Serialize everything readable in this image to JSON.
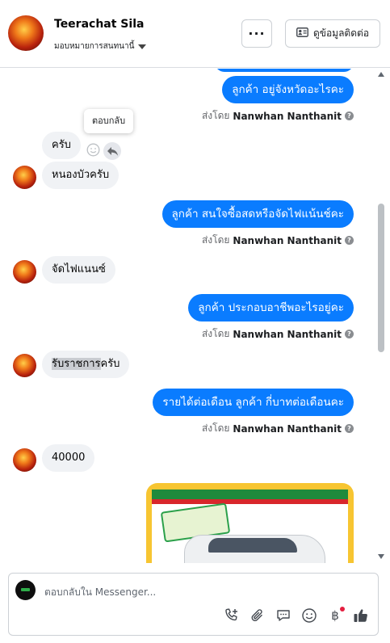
{
  "header": {
    "name": "Teerachat Sila",
    "assign_label": "มอบหมายการสนทนานี้",
    "more_label": "···",
    "contact_button_label": "ดูข้อมูลติดต่อ"
  },
  "messages": {
    "out_1": "ลูกค้า อยู่จังหวัดอะไรคะ",
    "sent_prefix": "ส่งโดย",
    "sender": "Nanwhan Nanthanit",
    "tooltip": "ตอบกลับ",
    "in_1": "ครับ",
    "in_2": "หนองบัวครับ",
    "out_2": "ลูกค้า สนใจซื้อสดหรือจัดไฟแน้นช์คะ",
    "in_3": "จัดไฟแนนซ์",
    "out_3": "ลูกค้า ประกอบอาชีพอะไรอยู่คะ",
    "in_4_highlight": "รับราชการ",
    "in_4_rest": "ครับ",
    "out_4": "รายได้ต่อเดือน ลูกค้า กี่บาทต่อเดือนคะ",
    "in_5": "40000"
  },
  "composer": {
    "placeholder": "ตอบกลับใน Messenger...",
    "baht_symbol": "฿"
  },
  "colors": {
    "accent": "#0a7cff",
    "bubble_in": "#f0f2f5",
    "notification": "#e41e3f"
  },
  "icons": [
    "more-icon",
    "contact-card-icon",
    "caret-down-icon",
    "info-icon",
    "emoji-icon",
    "reply-icon",
    "add-call-icon",
    "attach-icon",
    "saved-reply-icon",
    "emoji-icon",
    "baht-icon",
    "like-icon"
  ]
}
